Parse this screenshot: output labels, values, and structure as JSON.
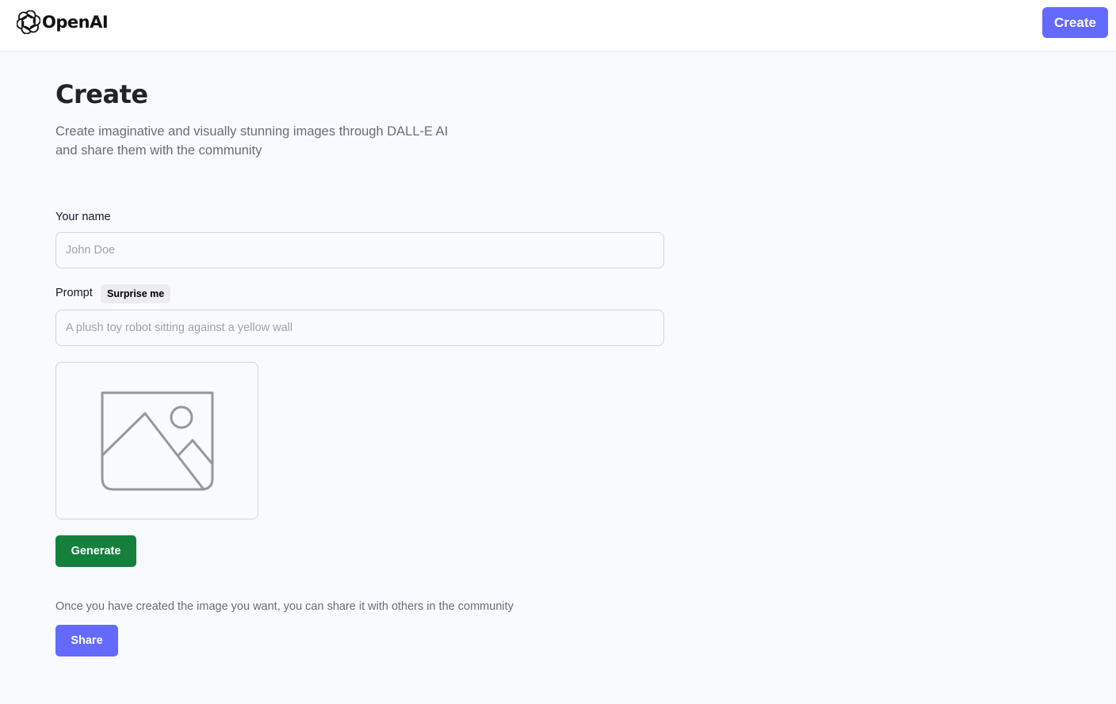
{
  "header": {
    "brand": "OpenAI",
    "create_label": "Create"
  },
  "main": {
    "title": "Create",
    "subtitle": "Create imaginative and visually stunning images through DALL-E AI and share them with the community"
  },
  "form": {
    "name_label": "Your name",
    "name_placeholder": "John Doe",
    "name_value": "",
    "prompt_label": "Prompt",
    "surprise_label": "Surprise me",
    "prompt_placeholder": "A plush toy robot sitting against a yellow wall",
    "prompt_value": "",
    "preview_icon": "image-placeholder-icon",
    "generate_label": "Generate",
    "share_note": "Once you have created the image you want, you can share it with others in the community",
    "share_label": "Share"
  },
  "colors": {
    "accent": "#6469ff",
    "generate": "#15803d",
    "background": "#f9fafe"
  }
}
